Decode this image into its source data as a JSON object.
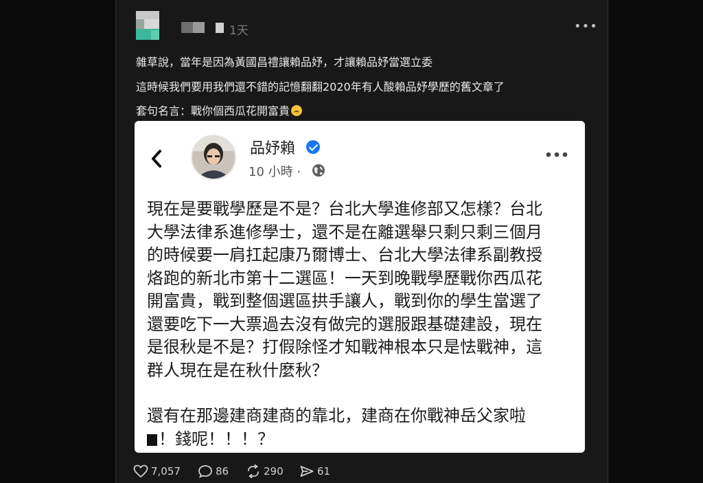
{
  "post": {
    "timestamp": "1天",
    "more_label": "•••",
    "lines": [
      "雜草說，當年是因為黃國昌禮讓賴品妤，才讓賴品妤當選立委",
      "這時候我們要用我們還不錯的記憶翻翻2020年有人酸賴品妤學歷的舊文章了",
      "套句名言：戰你個西瓜花開富貴"
    ],
    "emoji_icon": "upside-down-face-emoji",
    "actions": {
      "likes": "7,057",
      "comments": "86",
      "reposts": "290",
      "shares": "61"
    }
  },
  "embed": {
    "author": "品妤賴",
    "time": "10 小時 ·",
    "body_lines": [
      "現在是要戰學歷是不是？台北大學進修部又怎樣？台北",
      "大學法律系進修學士，還不是在離選舉只剩只剩三個月",
      "的時候要一肩扛起康乃爾博士、台北大學法律系副教授",
      "烙跑的新北市第十二選區！一天到晚戰學歷戰你西瓜花",
      "開富貴，戰到整個選區拱手讓人，戰到你的學生當選了",
      "還要吃下一大票過去沒有做完的選服跟基礎建設，現在",
      "是很秋是不是？打假除怪才知戰神根本只是怯戰神，這",
      "群人現在是在秋什麼秋？"
    ],
    "body_tail_1": "還有在那邊建商建商的靠北，建商在你戰神岳父家啦",
    "body_tail_2": "！錢呢！！！？"
  },
  "colors": {
    "background": "#0b0b0b",
    "card": "#181818",
    "verified_blue": "#1877f2"
  }
}
